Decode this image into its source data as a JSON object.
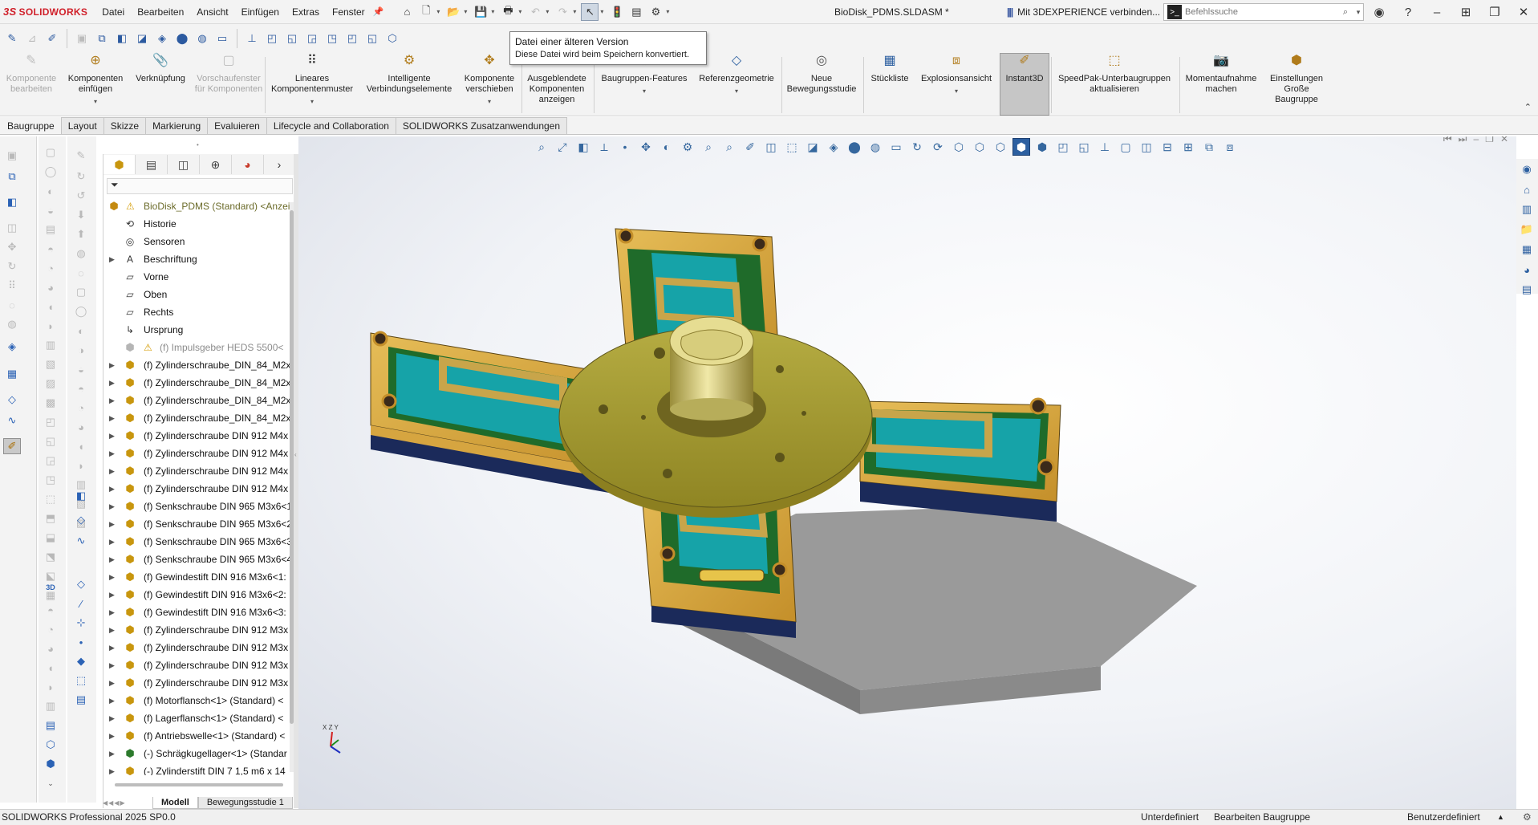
{
  "app": {
    "brand_ds": "3S",
    "brand": "SOLIDWORKS",
    "menu": [
      "Datei",
      "Bearbeiten",
      "Ansicht",
      "Einfügen",
      "Extras",
      "Fenster"
    ],
    "document_title": "BioDisk_PDMS.SLDASM *",
    "connect_3dx": "Mit 3DEXPERIENCE verbinden...",
    "search_placeholder": "Befehlssuche"
  },
  "tooltip": {
    "title": "Datei einer älteren Version",
    "body": "Diese Datei wird beim Speichern konvertiert."
  },
  "ribbon": [
    {
      "label": "Komponente bearbeiten",
      "disabled": true
    },
    {
      "label": "Komponenten einfügen",
      "disabled": false
    },
    {
      "label": "Verknüpfung",
      "disabled": false
    },
    {
      "label": "Vorschaufenster für Komponenten",
      "disabled": true
    },
    {
      "label": "Lineares Komponentenmuster",
      "disabled": false
    },
    {
      "label": "Intelligente Verbindungselemente",
      "disabled": false
    },
    {
      "label": "Komponente verschieben",
      "disabled": false
    },
    {
      "label": "Ausgeblendete Komponenten anzeigen",
      "disabled": false
    },
    {
      "label": "Baugruppen-Features",
      "disabled": false
    },
    {
      "label": "Referenzgeometrie",
      "disabled": false
    },
    {
      "label": "Neue Bewegungsstudie",
      "disabled": false
    },
    {
      "label": "Stückliste",
      "disabled": false
    },
    {
      "label": "Explosionsansicht",
      "disabled": false
    },
    {
      "label": "Instant3D",
      "disabled": false
    },
    {
      "label": "SpeedPak-Unterbaugruppen aktualisieren",
      "disabled": false
    },
    {
      "label": "Momentaufnahme machen",
      "disabled": false
    },
    {
      "label": "Einstellungen Große Baugruppe",
      "disabled": false
    }
  ],
  "tabs": [
    "Baugruppe",
    "Layout",
    "Skizze",
    "Markierung",
    "Evaluieren",
    "Lifecycle and Collaboration",
    "SOLIDWORKS Zusatzanwendungen"
  ],
  "tree": {
    "root": "BioDisk_PDMS (Standard) <Anzei",
    "items": [
      "Historie",
      "Sensoren",
      "Beschriftung",
      "Vorne",
      "Oben",
      "Rechts",
      "Ursprung",
      "(f) Impulsgeber HEDS 5500<",
      "(f) Zylinderschraube_DIN_84_M2x",
      "(f) Zylinderschraube_DIN_84_M2x",
      "(f) Zylinderschraube_DIN_84_M2x",
      "(f) Zylinderschraube_DIN_84_M2x",
      "(f) Zylinderschraube DIN 912 M4x",
      "(f) Zylinderschraube DIN 912 M4x",
      "(f) Zylinderschraube DIN 912 M4x",
      "(f) Zylinderschraube DIN 912 M4x",
      "(f) Senkschraube DIN 965 M3x6<1",
      "(f) Senkschraube DIN 965 M3x6<2",
      "(f) Senkschraube DIN 965 M3x6<3",
      "(f) Senkschraube DIN 965 M3x6<4",
      "(f) Gewindestift DIN 916 M3x6<1:",
      "(f) Gewindestift DIN 916 M3x6<2:",
      "(f) Gewindestift DIN 916 M3x6<3:",
      "(f) Zylinderschraube DIN 912 M3x",
      "(f) Zylinderschraube DIN 912 M3x",
      "(f) Zylinderschraube DIN 912 M3x",
      "(f) Zylinderschraube DIN 912 M3x",
      "(f) Motorflansch<1> (Standard) <",
      "(f) Lagerflansch<1> (Standard) <",
      "(f) Antriebswelle<1> (Standard) <",
      "(-) Schrägkugellager<1> (Standar",
      "(-) Zylinderstift DIN 7 1,5 m6 x 14"
    ]
  },
  "bottom_tabs": [
    "Modell",
    "Bewegungsstudie 1"
  ],
  "status": {
    "left": "SOLIDWORKS Professional 2025 SP0.0",
    "state": "Unterdefiniert",
    "mode": "Bearbeiten Baugruppe",
    "units": "Benutzerdefiniert"
  },
  "triad": {
    "x": "X",
    "y": "Y",
    "z": "Z"
  },
  "colors": {
    "brand": "#d0202a",
    "gold": "#c8960e",
    "teal": "#16a3a8",
    "green": "#1f6b2a",
    "navy": "#1b2a5a"
  }
}
